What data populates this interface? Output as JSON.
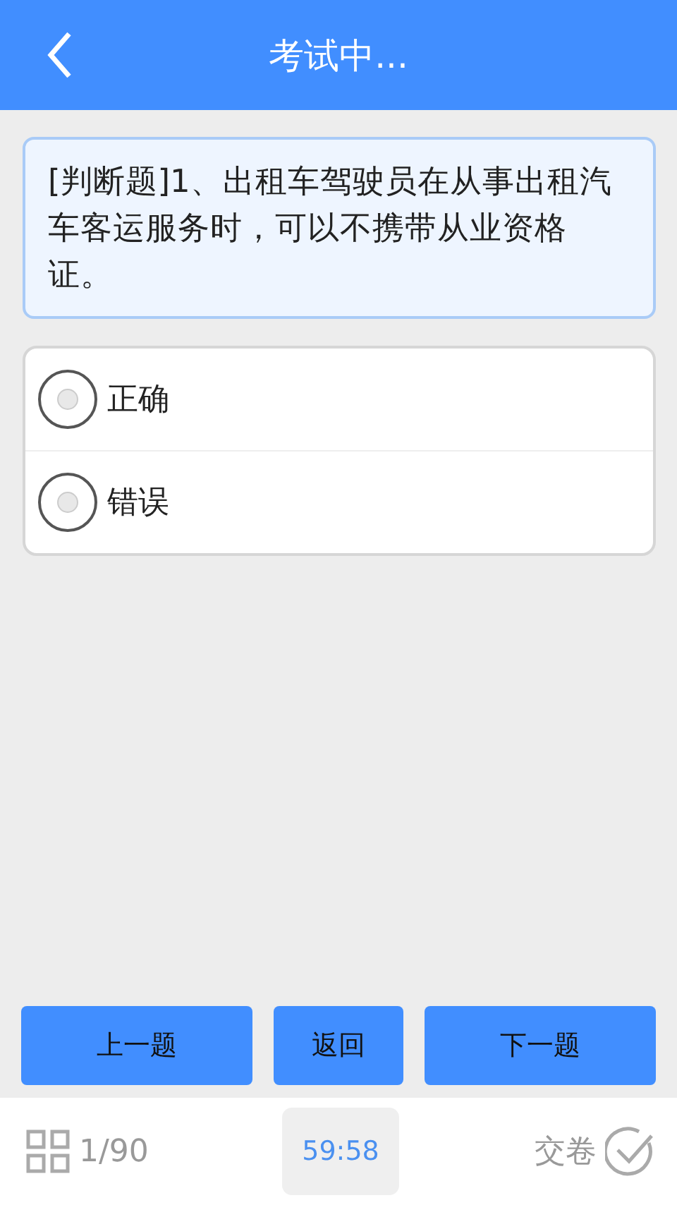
{
  "header": {
    "title": "考试中..."
  },
  "question": {
    "text": "[判断题]1、出租车驾驶员在从事出租汽车客运服务时，可以不携带从业资格证。"
  },
  "options": [
    {
      "label": "正确",
      "selected": false
    },
    {
      "label": "错误",
      "selected": false
    }
  ],
  "buttons": [
    {
      "label": "上一题",
      "kind": "wide"
    },
    {
      "label": "返回",
      "kind": "narrow"
    },
    {
      "label": "下一题",
      "kind": "wide"
    }
  ],
  "bottom_bar": {
    "progress": "1/90",
    "timer": "59:58",
    "submit": "交卷"
  }
}
